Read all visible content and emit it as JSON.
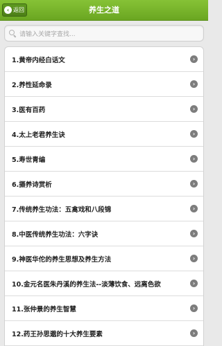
{
  "header": {
    "back_label": "返回",
    "title": "养生之道"
  },
  "search": {
    "placeholder": "请输入关键字查找..."
  },
  "list": {
    "items": [
      {
        "label": "1.黄帝内经白话文"
      },
      {
        "label": "2.养性延命录"
      },
      {
        "label": "3.医有百药"
      },
      {
        "label": "4.太上老君养生诀"
      },
      {
        "label": "5.寿世青编"
      },
      {
        "label": "6.摄养诗赏析"
      },
      {
        "label": "7.传统养生功法：五禽戏和八段锦"
      },
      {
        "label": "8.中医传统养生功法：六字诀"
      },
      {
        "label": "9.神医华佗的养生思想及养生方法"
      },
      {
        "label": "10.金元名医朱丹溪的养生法--淡薄饮食、远离色欲"
      },
      {
        "label": "11.张仲景的养生智慧"
      },
      {
        "label": "12.药王孙思邈的十大养生要素"
      }
    ]
  },
  "colors": {
    "header_green": "#79b52c",
    "chevron_gray": "#7d7d7d"
  },
  "icons": {
    "back": "back-arrow-icon",
    "search": "search-icon",
    "row": "chevron-right-icon"
  }
}
